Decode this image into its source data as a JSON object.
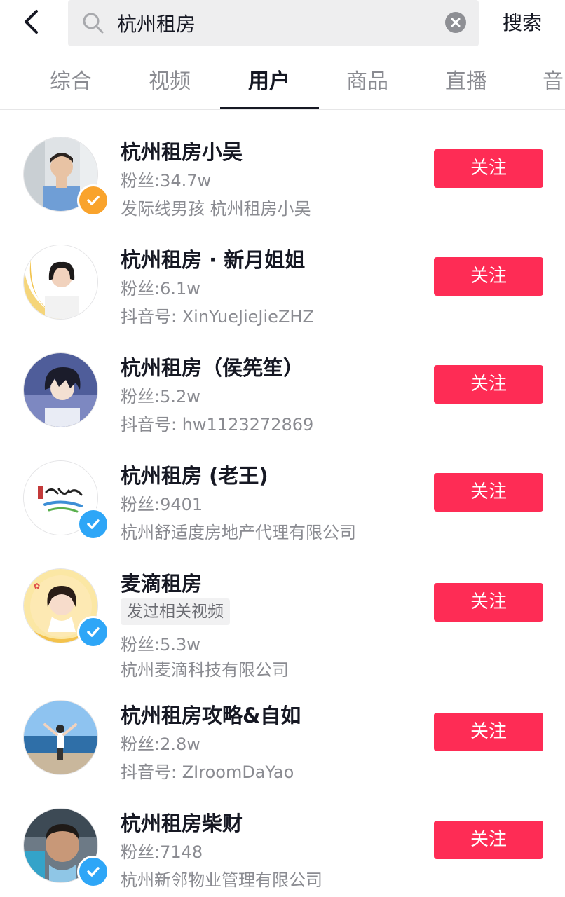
{
  "search": {
    "query": "杭州租房",
    "button_label": "搜索"
  },
  "tabs": [
    {
      "label": "综合",
      "active": false
    },
    {
      "label": "视频",
      "active": false
    },
    {
      "label": "用户",
      "active": true
    },
    {
      "label": "商品",
      "active": false
    },
    {
      "label": "直播",
      "active": false
    },
    {
      "label": "音",
      "active": false
    }
  ],
  "users": [
    {
      "name": "杭州租房小吴",
      "fans": "粉丝:34.7w",
      "detail": "发际线男孩   杭州租房小吴",
      "badge": "orange-verified-badge",
      "follow_label": "关注"
    },
    {
      "name": "杭州租房 · 新月姐姐",
      "fans": "粉丝:6.1w",
      "detail": "抖音号: XinYueJieJieZHZ",
      "badge": "",
      "follow_label": "关注"
    },
    {
      "name": "杭州租房（侯筅笙）",
      "fans": "粉丝:5.2w",
      "detail": "抖音号: hw1123272869",
      "badge": "",
      "follow_label": "关注"
    },
    {
      "name": "杭州租房 (老王)",
      "fans": "粉丝:9401",
      "detail": "杭州舒适度房地产代理有限公司",
      "badge": "blue-verified-badge",
      "follow_label": "关注"
    },
    {
      "name": "麦滴租房",
      "tag": "发过相关视频",
      "fans": "粉丝:5.3w",
      "detail": "杭州麦滴科技有限公司",
      "badge": "blue-verified-badge",
      "follow_label": "关注"
    },
    {
      "name": "杭州租房攻略&自如",
      "fans": "粉丝:2.8w",
      "detail": "抖音号: ZIroomDaYao",
      "badge": "",
      "follow_label": "关注"
    },
    {
      "name": "杭州租房柴财",
      "fans": "粉丝:7148",
      "detail": "杭州新邻物业管理有限公司",
      "badge": "blue-verified-badge",
      "follow_label": "关注"
    }
  ],
  "colors": {
    "accent": "#fe2c55",
    "verified_orange": "#f9a32c",
    "verified_blue": "#2ea6f7",
    "text_primary": "#161823",
    "text_secondary": "#8a8b91"
  }
}
